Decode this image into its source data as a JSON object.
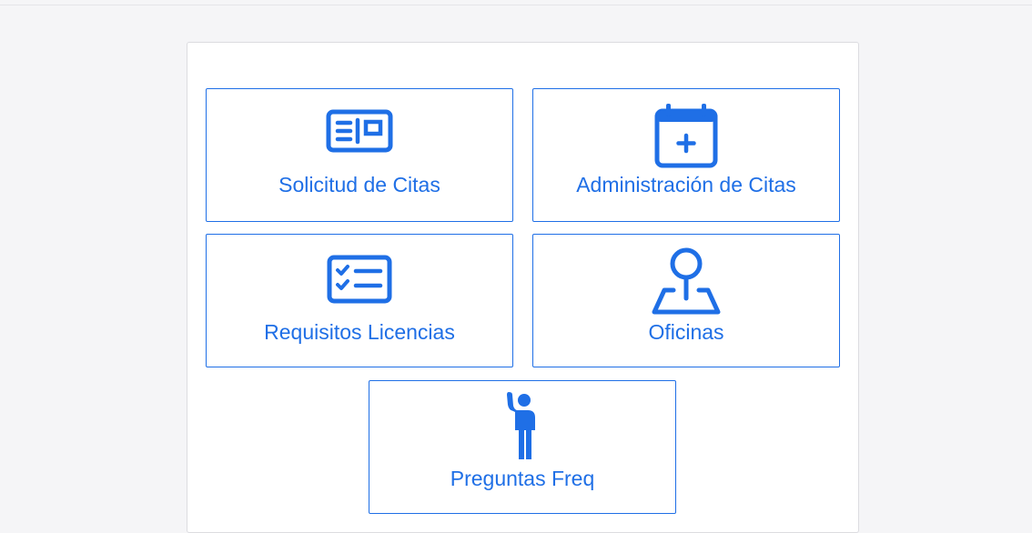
{
  "colors": {
    "accent": "#1f6fe6",
    "page_background": "#f5f5f7",
    "card_background": "#ffffff"
  },
  "menu": {
    "tiles": [
      {
        "label": "Solicitud de Citas",
        "icon": "id-card-icon"
      },
      {
        "label": "Administración de Citas",
        "icon": "calendar-add-icon"
      },
      {
        "label": "Requisitos Licencias",
        "icon": "checklist-icon"
      },
      {
        "label": "Oficinas",
        "icon": "map-pin-icon"
      },
      {
        "label": "Preguntas Freq",
        "icon": "person-raising-hand-icon"
      }
    ]
  }
}
